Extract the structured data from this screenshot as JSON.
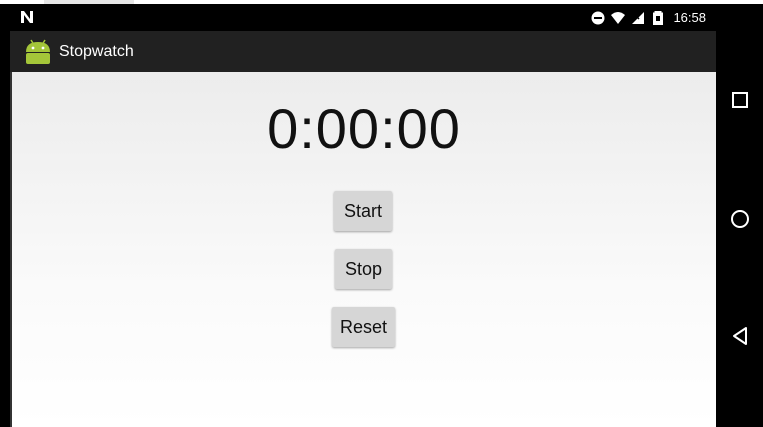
{
  "status_bar": {
    "time": "16:58",
    "icons": [
      "notification-n-icon",
      "do-not-disturb-icon",
      "wifi-icon",
      "no-signal-icon",
      "battery-icon"
    ]
  },
  "app": {
    "title": "Stopwatch",
    "icon": "android-icon"
  },
  "stopwatch": {
    "time": "0:00:00",
    "start_label": "Start",
    "stop_label": "Stop",
    "reset_label": "Reset"
  },
  "nav": {
    "icons": [
      "recent-apps-icon",
      "home-icon",
      "back-icon"
    ]
  },
  "colors": {
    "action_bar": "#212121",
    "button": "#d6d6d6",
    "android_green": "#a4c639"
  }
}
